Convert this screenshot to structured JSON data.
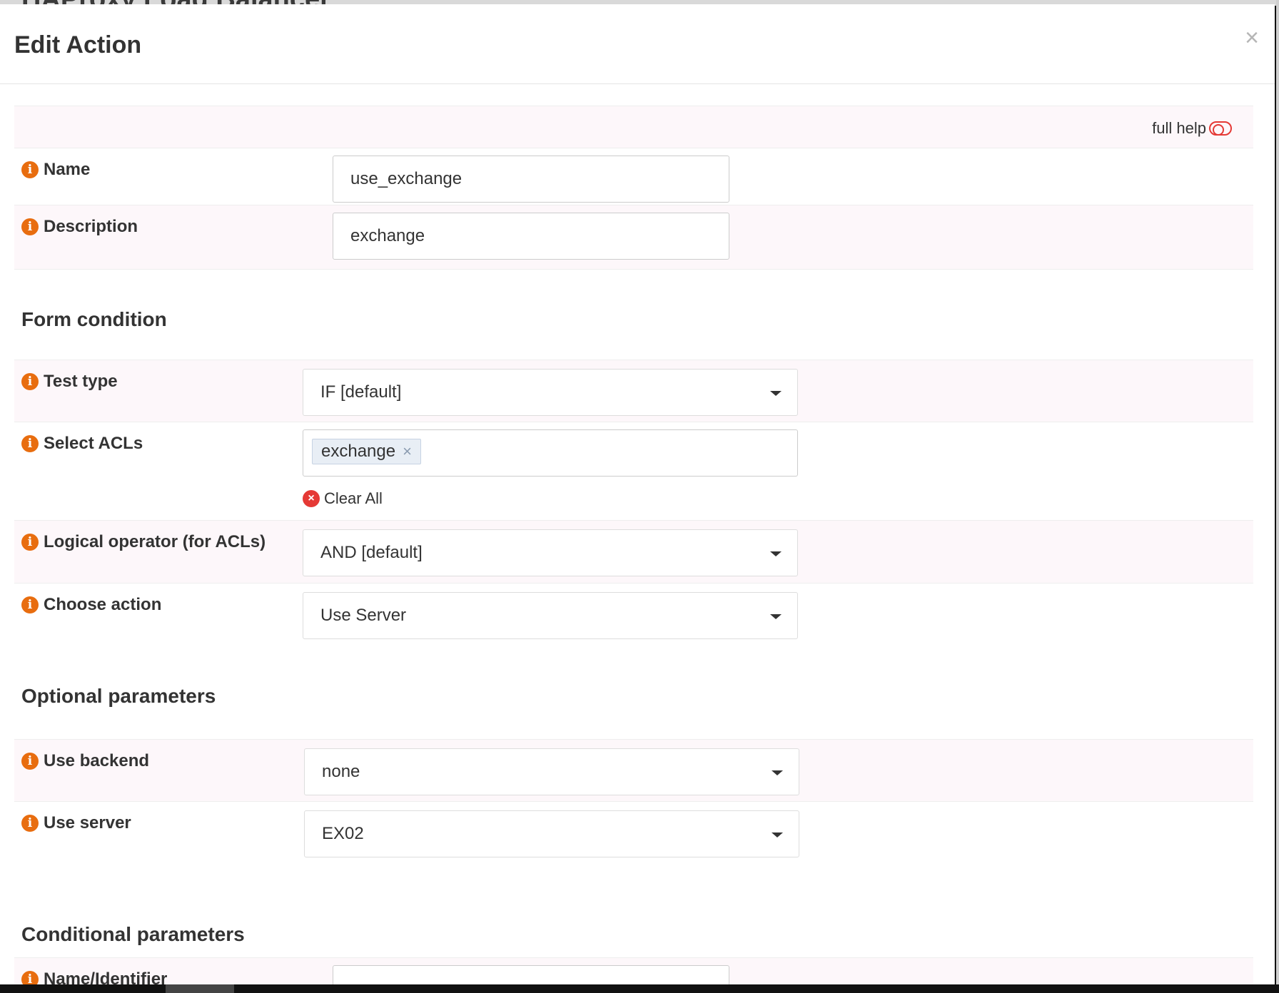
{
  "background": {
    "page_title": "HAProxy Load Balancer"
  },
  "modal": {
    "title": "Edit Action",
    "close_label": "×",
    "full_help_label": "full help"
  },
  "fields": {
    "name": {
      "label": "Name",
      "value": "use_exchange"
    },
    "description": {
      "label": "Description",
      "value": "exchange"
    }
  },
  "sections": {
    "form_condition": "Form condition",
    "optional_parameters": "Optional parameters",
    "conditional_parameters": "Conditional parameters"
  },
  "form_condition": {
    "test_type": {
      "label": "Test type",
      "value": "IF [default]"
    },
    "select_acls": {
      "label": "Select ACLs",
      "tags": [
        "exchange"
      ],
      "tag_remove": "×",
      "clear_all": "Clear All"
    },
    "logical_operator": {
      "label": "Logical operator (for ACLs)",
      "value": "AND [default]"
    },
    "choose_action": {
      "label": "Choose action",
      "value": "Use Server"
    }
  },
  "optional_parameters": {
    "use_backend": {
      "label": "Use backend",
      "value": "none"
    },
    "use_server": {
      "label": "Use server",
      "value": "EX02"
    }
  },
  "conditional_parameters": {
    "name_identifier": {
      "label": "Name/Identifier",
      "value": ""
    }
  },
  "icons": {
    "info": "info-icon",
    "clear": "clear-icon",
    "toggle": "toggle-icon"
  },
  "colors": {
    "info_icon": "#e86d0f",
    "clear_icon": "#e53935",
    "row_alt_bg": "#fdf7fa",
    "tag_bg": "#e8eef5"
  }
}
